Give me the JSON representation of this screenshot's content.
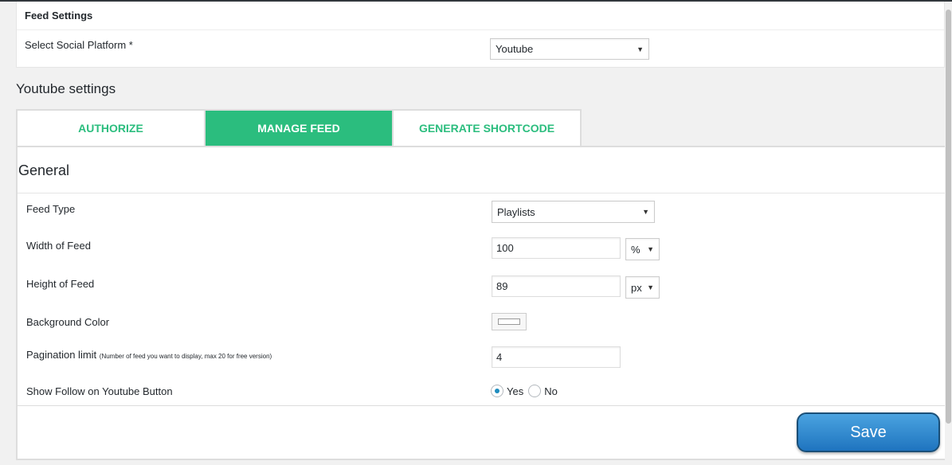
{
  "feed_settings": {
    "title": "Feed Settings",
    "platform_label": "Select Social Platform *",
    "platform_value": "Youtube"
  },
  "section_title": "Youtube settings",
  "tabs": [
    {
      "label": "AUTHORIZE",
      "active": false
    },
    {
      "label": "MANAGE FEED",
      "active": true
    },
    {
      "label": "GENERATE SHORTCODE",
      "active": false
    }
  ],
  "general": {
    "title": "General",
    "feed_type": {
      "label": "Feed Type",
      "value": "Playlists"
    },
    "width": {
      "label": "Width of Feed",
      "value": "100",
      "unit": "%"
    },
    "height": {
      "label": "Height of Feed",
      "value": "89",
      "unit": "px"
    },
    "background_color": {
      "label": "Background Color",
      "value": "#ffffff"
    },
    "pagination": {
      "label": "Pagination limit",
      "hint": "(Number of feed you want to display, max 20 for free version)",
      "value": "4"
    },
    "follow_button": {
      "label": "Show Follow on Youtube Button",
      "options": [
        "Yes",
        "No"
      ],
      "selected": "Yes"
    }
  },
  "save_label": "Save",
  "colors": {
    "accent_green": "#2bbd7e",
    "save_blue": "#1f74bf"
  }
}
